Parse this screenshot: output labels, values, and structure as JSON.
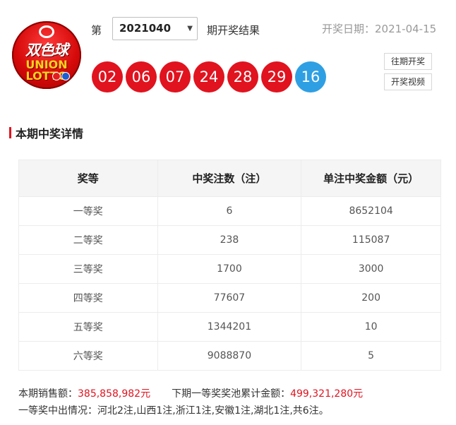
{
  "logo": {
    "cn_text": "双色球",
    "en_line1": "UNION",
    "en_line2": "LOTTO"
  },
  "header": {
    "di_label": "第",
    "issue_value": "2021040",
    "issue_suffix": "期开奖结果",
    "date_label": "开奖日期：2021-04-15",
    "dropdown_icon": "▼"
  },
  "balls": {
    "red": [
      "02",
      "06",
      "07",
      "24",
      "28",
      "29"
    ],
    "blue": "16",
    "red_color": "#e0131f",
    "blue_color": "#2f9fe3"
  },
  "buttons": {
    "history": "往期开奖",
    "video": "开奖视频"
  },
  "section": {
    "title": "本期中奖详情"
  },
  "table": {
    "headers": [
      "奖等",
      "中奖注数（注）",
      "单注中奖金额（元）"
    ],
    "rows": [
      {
        "level": "一等奖",
        "count": "6",
        "amount": "8652104"
      },
      {
        "level": "二等奖",
        "count": "238",
        "amount": "115087"
      },
      {
        "level": "三等奖",
        "count": "1700",
        "amount": "3000"
      },
      {
        "level": "四等奖",
        "count": "77607",
        "amount": "200"
      },
      {
        "level": "五等奖",
        "count": "1344201",
        "amount": "10"
      },
      {
        "level": "六等奖",
        "count": "9088870",
        "amount": "5"
      }
    ]
  },
  "footer": {
    "sales_label": "本期销售额：",
    "sales_value": "385,858,982元",
    "pool_label": "下期一等奖奖池累计金额：",
    "pool_value": "499,321,280元",
    "winners_text": "一等奖中出情况：河北2注,山西1注,浙江1注,安徽1注,湖北1注,共6注。"
  }
}
